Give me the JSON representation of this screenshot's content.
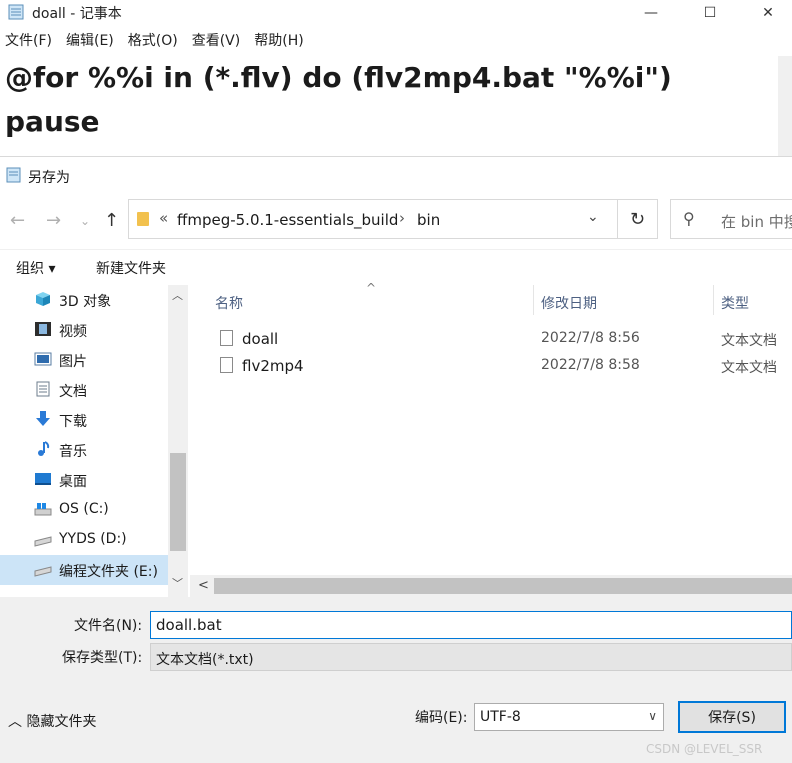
{
  "notepad": {
    "title": "doall - 记事本",
    "menu": [
      "文件(F)",
      "编辑(E)",
      "格式(O)",
      "查看(V)",
      "帮助(H)"
    ],
    "lines": [
      "@for %%i in (*.flv) do (flv2mp4.bat \"%%i\")",
      "pause"
    ]
  },
  "dialog": {
    "title": "另存为",
    "address": {
      "prefix": "«",
      "segment1": "ffmpeg-5.0.1-essentials_build",
      "separator": "›",
      "segment2": "bin"
    },
    "search_placeholder": "在 bin 中搜",
    "toolbar": {
      "organize": "组织 ▾",
      "new_folder": "新建文件夹"
    },
    "nav_items": [
      {
        "label": "3D 对象",
        "icon": "cube-icon"
      },
      {
        "label": "视频",
        "icon": "film-icon"
      },
      {
        "label": "图片",
        "icon": "picture-icon"
      },
      {
        "label": "文档",
        "icon": "document-icon"
      },
      {
        "label": "下载",
        "icon": "download-arrow-icon"
      },
      {
        "label": "音乐",
        "icon": "music-note-icon"
      },
      {
        "label": "桌面",
        "icon": "desktop-icon"
      },
      {
        "label": "OS (C:)",
        "icon": "windows-drive-icon"
      },
      {
        "label": "YYDS (D:)",
        "icon": "drive-icon"
      },
      {
        "label": "编程文件夹 (E:)",
        "icon": "drive-icon"
      }
    ],
    "columns": {
      "name": "名称",
      "modified": "修改日期",
      "type": "类型"
    },
    "files": [
      {
        "name": "doall",
        "modified": "2022/7/8 8:56",
        "type": "文本文档"
      },
      {
        "name": "flv2mp4",
        "modified": "2022/7/8 8:58",
        "type": "文本文档"
      }
    ],
    "filename_label": "文件名(N):",
    "filename_value": "doall.bat",
    "filetype_label": "保存类型(T):",
    "filetype_value": "文本文档(*.txt)",
    "hide_folders": "隐藏文件夹",
    "encoding_label": "编码(E):",
    "encoding_value": "UTF-8",
    "save_button": "保存(S)"
  },
  "watermark": "CSDN @LEVEL_SSR",
  "colors": {
    "accent": "#0078d7",
    "selection": "#cce4f7"
  }
}
